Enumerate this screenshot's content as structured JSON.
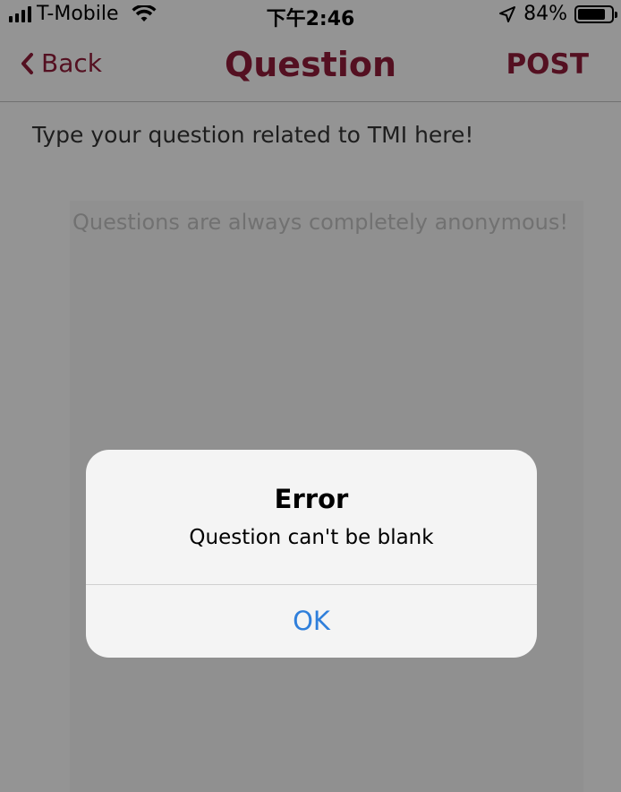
{
  "status_bar": {
    "carrier": "T-Mobile",
    "time": "下午2:46",
    "battery_text": "84%",
    "battery_level": 0.84
  },
  "nav": {
    "back_label": "Back",
    "title": "Question",
    "post_label": "POST",
    "accent_color": "#8d1c37"
  },
  "form": {
    "prompt": "Type your question related to TMI here!",
    "question_value": "",
    "question_placeholder": "Questions are always completely anonymous!"
  },
  "alert": {
    "title": "Error",
    "message": "Question can't be blank",
    "ok_label": "OK",
    "ok_color": "#2f7fdb"
  },
  "icons": {
    "signal": "signal-icon",
    "wifi": "wifi-icon",
    "location": "location-arrow-icon",
    "battery": "battery-icon",
    "back": "chevron-left-icon"
  }
}
